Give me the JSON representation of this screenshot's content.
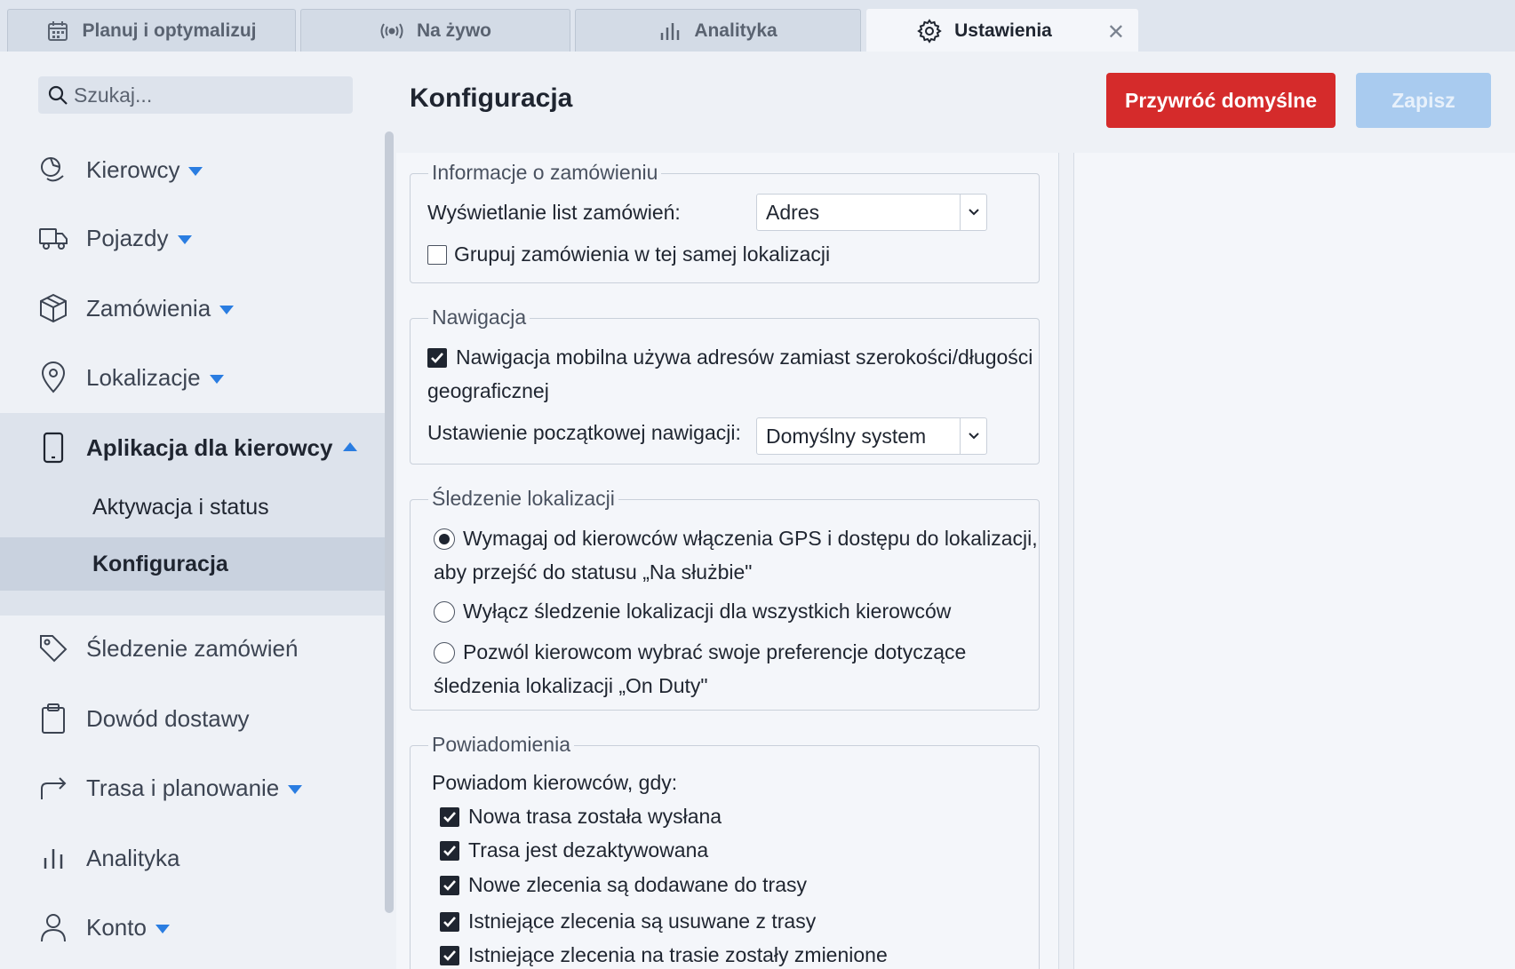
{
  "tabs": [
    {
      "label": "Planuj i optymalizuj",
      "icon": "calendar-icon"
    },
    {
      "label": "Na żywo",
      "icon": "broadcast-icon"
    },
    {
      "label": "Analityka",
      "icon": "bar-chart-icon"
    },
    {
      "label": "Ustawienia",
      "icon": "gear-icon",
      "active": true,
      "close": "✕"
    }
  ],
  "search": {
    "placeholder": "Szukaj..."
  },
  "sidebar": {
    "items": [
      {
        "label": "Kierowcy",
        "icon": "drivers-icon",
        "expandable": true
      },
      {
        "label": "Pojazdy",
        "icon": "truck-icon",
        "expandable": true
      },
      {
        "label": "Zamówienia",
        "icon": "package-icon",
        "expandable": true
      },
      {
        "label": "Lokalizacje",
        "icon": "map-pin-icon",
        "expandable": true
      },
      {
        "label": "Aplikacja dla kierowcy",
        "icon": "phone-icon",
        "expanded": true
      },
      {
        "label": "Śledzenie zamówień",
        "icon": "tag-icon"
      },
      {
        "label": "Dowód dostawy",
        "icon": "clipboard-icon"
      },
      {
        "label": "Trasa i planowanie",
        "icon": "route-arrow-icon",
        "expandable": true
      },
      {
        "label": "Analityka",
        "icon": "bar-chart-icon"
      },
      {
        "label": "Konto",
        "icon": "user-icon",
        "expandable": true
      }
    ],
    "subitems": [
      {
        "label": "Aktywacja i status"
      },
      {
        "label": "Konfiguracja",
        "selected": true
      }
    ]
  },
  "main": {
    "title": "Konfiguracja",
    "reset_label": "Przywróć domyślne",
    "save_label": "Zapisz",
    "colors": {
      "danger": "#d52b2b",
      "primary_disabled": "#a9cbef",
      "accent": "#2a7de1"
    }
  },
  "order_info": {
    "legend": "Informacje o zamówieniu",
    "display_label": "Wyświetlanie list zamówień:",
    "display_value": "Adres",
    "group_label": "Grupuj zamówienia w tej samej lokalizacji",
    "group_checked": false
  },
  "navigation": {
    "legend": "Nawigacja",
    "mobile_label_line1": "Nawigacja mobilna używa adresów zamiast szerokości/długości",
    "mobile_label_line2": "geograficznej",
    "mobile_checked": true,
    "initial_label": "Ustawienie początkowej nawigacji:",
    "initial_value": "Domyślny system"
  },
  "tracking": {
    "legend": "Śledzenie lokalizacji",
    "options": [
      {
        "line1": "Wymagaj od kierowców włączenia GPS i dostępu do lokalizacji,",
        "line2": "aby przejść do statusu „Na służbie\"",
        "checked": true
      },
      {
        "line1": "Wyłącz śledzenie lokalizacji dla wszystkich kierowców",
        "line2": "",
        "checked": false
      },
      {
        "line1": "Pozwól kierowcom wybrać swoje preferencje dotyczące",
        "line2": "śledzenia lokalizacji „On Duty\"",
        "checked": false
      }
    ]
  },
  "notifications": {
    "legend": "Powiadomienia",
    "intro": "Powiadom kierowców, gdy:",
    "items": [
      {
        "label": "Nowa trasa została wysłana",
        "checked": true
      },
      {
        "label": "Trasa jest dezaktywowana",
        "checked": true
      },
      {
        "label": "Nowe zlecenia są dodawane do trasy",
        "checked": true
      },
      {
        "label": "Istniejące zlecenia są usuwane z trasy",
        "checked": true
      },
      {
        "label": "Istniejące zlecenia na trasie zostały zmienione",
        "checked": true
      }
    ]
  }
}
